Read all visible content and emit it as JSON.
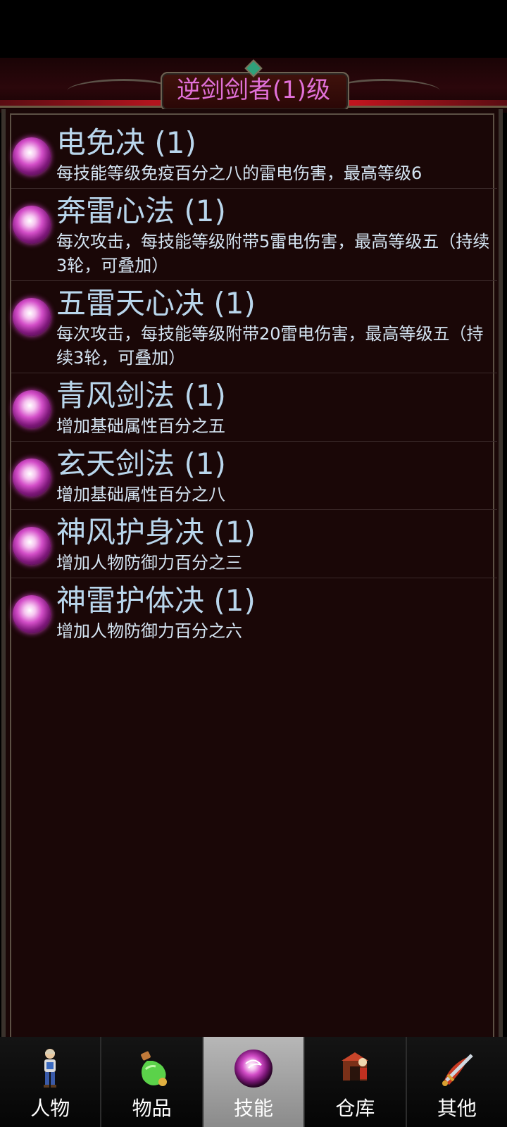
{
  "header": {
    "title": "逆剑剑者(1)级"
  },
  "skills": [
    {
      "name": "电免决 (1)",
      "desc": "每技能等级免疫百分之八的雷电伤害，最高等级6"
    },
    {
      "name": "奔雷心法 (1)",
      "desc": "每次攻击，每技能等级附带5雷电伤害，最高等级五（持续3轮，可叠加）"
    },
    {
      "name": "五雷天心决 (1)",
      "desc": "每次攻击，每技能等级附带20雷电伤害，最高等级五（持续3轮，可叠加）"
    },
    {
      "name": "青风剑法 (1)",
      "desc": "增加基础属性百分之五"
    },
    {
      "name": "玄天剑法 (1)",
      "desc": "增加基础属性百分之八"
    },
    {
      "name": "神风护身决 (1)",
      "desc": "增加人物防御力百分之三"
    },
    {
      "name": "神雷护体决 (1)",
      "desc": "增加人物防御力百分之六"
    }
  ],
  "nav": {
    "tabs": [
      {
        "label": "人物",
        "icon": "character-icon"
      },
      {
        "label": "物品",
        "icon": "potion-icon"
      },
      {
        "label": "技能",
        "icon": "skill-orb-icon",
        "active": true
      },
      {
        "label": "仓库",
        "icon": "warehouse-icon"
      },
      {
        "label": "其他",
        "icon": "other-sword-icon"
      }
    ]
  },
  "colors": {
    "title": "#e070d8",
    "skill_name": "#b9d6ec",
    "skill_desc": "#d4e4f2",
    "panel_bg": "#1a0707",
    "active_tab": "#a8a8a8"
  }
}
